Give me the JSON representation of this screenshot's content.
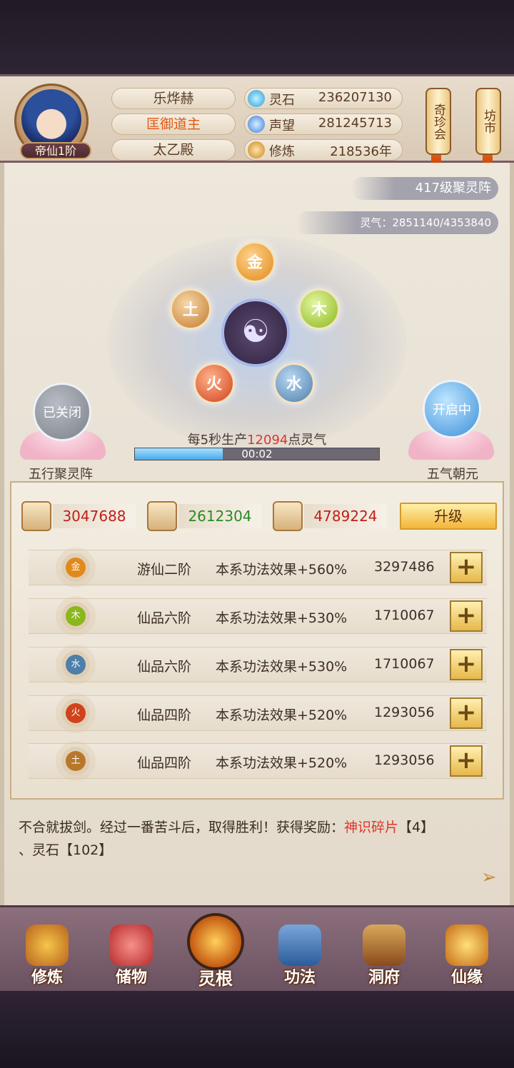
{
  "player": {
    "name": "乐烨赫",
    "title": "匡御道主",
    "sect": "太乙殿",
    "rank_badge": "帝仙1阶"
  },
  "stats": [
    {
      "label": "灵石",
      "value": "236207130",
      "icon": "spirit-stone-icon"
    },
    {
      "label": "声望",
      "value": "281245713",
      "icon": "prestige-icon"
    },
    {
      "label": "修炼",
      "value": "218536年",
      "icon": "cultivation-icon"
    }
  ],
  "side_buttons": {
    "treasure": "奇珍会",
    "market": "坊市"
  },
  "array": {
    "level_banner": "417级聚灵阵",
    "qi_banner": "灵气：2851140/4353840",
    "elements": [
      "金",
      "木",
      "水",
      "火",
      "土"
    ],
    "left_toggle": {
      "status": "已关闭",
      "label": "五行聚灵阵"
    },
    "right_toggle": {
      "status": "开启中",
      "label": "五气朝元"
    },
    "produce_prefix": "每5秒生产",
    "produce_value": "12094",
    "produce_suffix": "点灵气",
    "progress_time": "00:02",
    "progress_fraction": 0.36
  },
  "resources": [
    {
      "value": "3047688",
      "color": "#c0201a",
      "icon": "book-icon"
    },
    {
      "value": "2612304",
      "color": "#2a8a22",
      "icon": "wood-icon"
    },
    {
      "value": "4789224",
      "color": "#c0201a",
      "icon": "herb-icon"
    }
  ],
  "upgrade_label": "升级",
  "roots": [
    {
      "element": "金",
      "rank": "游仙二阶",
      "effect": "本系功法效果+560%",
      "cost": "3297486",
      "color": "#e08a1c"
    },
    {
      "element": "木",
      "rank": "仙品六阶",
      "effect": "本系功法效果+530%",
      "cost": "1710067",
      "color": "#8ab71c"
    },
    {
      "element": "水",
      "rank": "仙品六阶",
      "effect": "本系功法效果+530%",
      "cost": "1710067",
      "color": "#4d7fa9"
    },
    {
      "element": "火",
      "rank": "仙品四阶",
      "effect": "本系功法效果+520%",
      "cost": "1293056",
      "color": "#d0421c"
    },
    {
      "element": "土",
      "rank": "仙品四阶",
      "effect": "本系功法效果+520%",
      "cost": "1293056",
      "color": "#b8782a"
    }
  ],
  "plus_label": "+",
  "log": {
    "text1": "不合就拔剑。经过一番苦斗后，取得胜利！获得奖励：",
    "reward1": "神识碎片",
    "text2": "【4】",
    "text3": "、灵石【102】"
  },
  "nav": [
    {
      "label": "修炼",
      "icon": "cultivation-monk-icon"
    },
    {
      "label": "储物",
      "icon": "storage-bag-icon"
    },
    {
      "label": "灵根",
      "icon": "spirit-root-icon"
    },
    {
      "label": "功法",
      "icon": "scripture-book-icon"
    },
    {
      "label": "洞府",
      "icon": "cave-mansion-icon"
    },
    {
      "label": "仙缘",
      "icon": "gourd-icon"
    }
  ]
}
